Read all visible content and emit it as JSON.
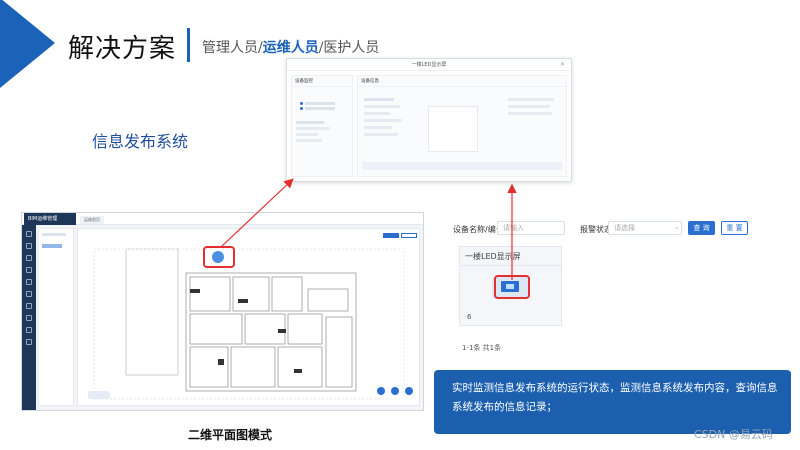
{
  "header": {
    "title": "解决方案",
    "roles": [
      "管理人员/",
      "运维人员",
      "/医护人员"
    ]
  },
  "section_label": "信息发布系统",
  "dialog": {
    "title": "一楼LED显示屏",
    "left_title": "设备监控",
    "right_title": "设备信息"
  },
  "floor_app": {
    "logo": "BIM运维管理",
    "tab": "运维首页"
  },
  "caption": "二维平面图模式",
  "list_panel": {
    "name_label": "设备名称/编号：",
    "name_placeholder": "请输入",
    "status_label": "报警状态：",
    "status_placeholder": "请选择",
    "query_button": "查 询",
    "reset_button": "重 置",
    "card_title": "一楼LED显示屏",
    "card_count": "6",
    "pager": "1-1条 共1条"
  },
  "note": "实时监测信息发布系统的运行状态，监测信息系统发布内容，查询信息系统发布的信息记录；",
  "watermark": "CSDN @易云码",
  "colors": {
    "accent": "#1a63b8",
    "highlight": "#e23030",
    "note_bg": "#1b5fae"
  }
}
